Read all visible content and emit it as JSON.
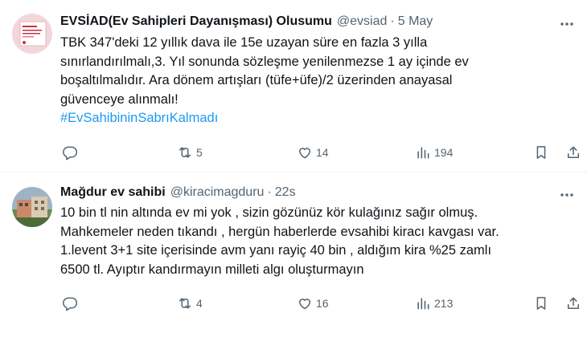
{
  "tweets": [
    {
      "name": "EVSİAD(Ev Sahipleri Dayanışması) Olusumu",
      "handle": "@evsiad",
      "separator": "·",
      "time": "5 May",
      "text": "TBK 347'deki 12 yıllık dava ile 15e uzayan süre en fazla 3 yılla\nsınırlandırılmalı,3. Yıl sonunda sözleşme yenilenmezse 1 ay içinde ev\nboşaltılmalıdır. Ara dönem artışları (tüfe+üfe)/2 üzerinden anayasal\ngüvenceye alınmalı!",
      "hashtag": "#EvSahibininSabrıKalmadı",
      "retweets": "5",
      "likes": "14",
      "views": "194",
      "icons": [
        "reply-icon",
        "retweet-icon",
        "like-icon",
        "views-icon",
        "bookmark-icon",
        "share-icon"
      ]
    },
    {
      "name": "Mağdur ev sahibi",
      "handle": "@kiracimagduru",
      "separator": "·",
      "time": "22s",
      "text": "10 bin tl nin altında ev mi yok , sizin gözünüz kör kulağınız sağır olmuş.\nMahkemeler neden tıkandı , hergün haberlerde evsahibi kiracı kavgası var.\n1.levent 3+1 site içerisinde avm yanı rayiç 40 bin , aldığım kira %25 zamlı\n6500 tl. Ayıptır kandırmayın milleti algı oluşturmayın",
      "retweets": "4",
      "likes": "16",
      "views": "213",
      "icons": [
        "reply-icon",
        "retweet-icon",
        "like-icon",
        "views-icon",
        "bookmark-icon",
        "share-icon"
      ]
    }
  ],
  "colors": {
    "text": "#0f1419",
    "secondary": "#536471",
    "link": "#1d9bf0",
    "divider": "#eff3f4"
  }
}
